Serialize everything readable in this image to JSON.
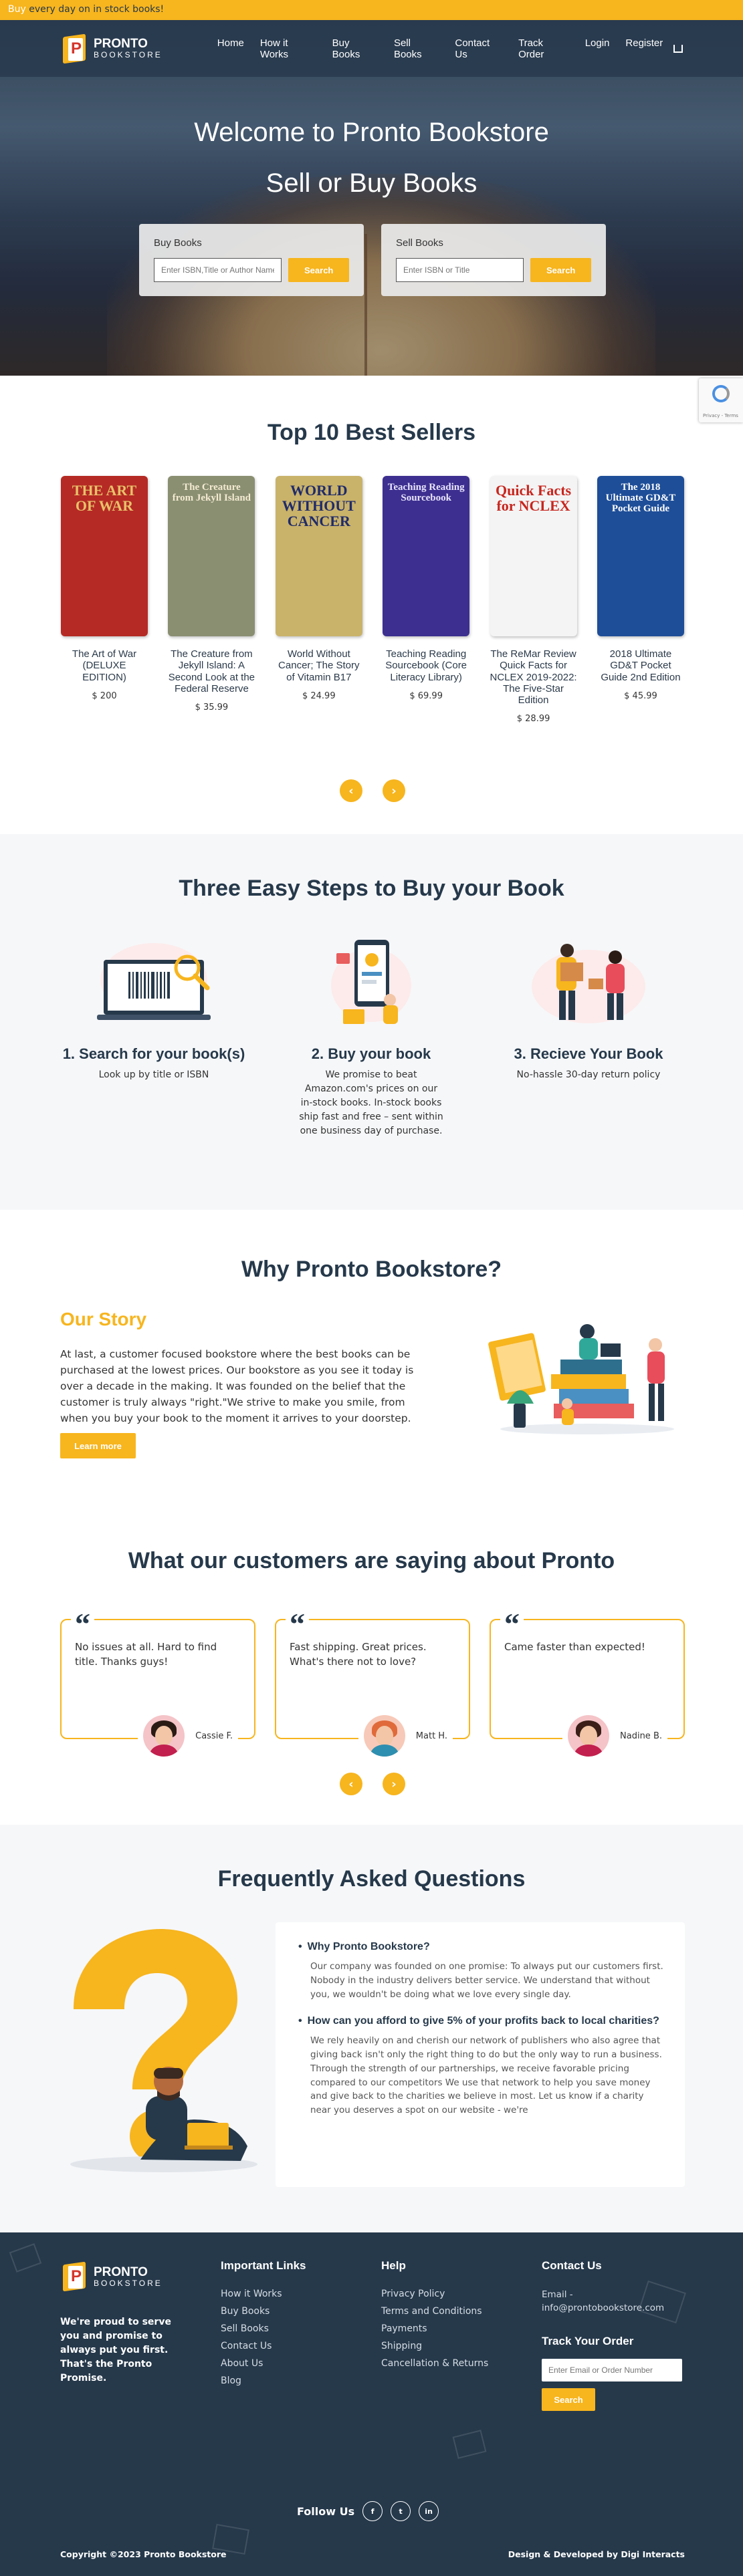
{
  "topbar": {
    "accent": "Buy",
    "text": "every day on in stock books!"
  },
  "brand": {
    "name": "PRONTO",
    "sub": "BOOKSTORE",
    "logo_letter": "P"
  },
  "nav": {
    "items": [
      "Home",
      "How it Works",
      "Buy Books",
      "Sell Books",
      "Contact Us",
      "Track Order",
      "Login",
      "Register"
    ],
    "cart_icon": "cart-icon"
  },
  "hero": {
    "title": "Welcome to Pronto Bookstore",
    "subtitle": "Sell or Buy Books",
    "buy": {
      "label": "Buy Books",
      "placeholder": "Enter ISBN,Title or Author Name",
      "button": "Search"
    },
    "sell": {
      "label": "Sell Books",
      "placeholder": "Enter ISBN or Title",
      "button": "Search"
    }
  },
  "recaptcha": {
    "text": "Privacy - Terms"
  },
  "bestsellers": {
    "title": "Top 10 Best Sellers",
    "books": [
      {
        "title": "The Art of War (DELUXE EDITION)",
        "price": "$ 200",
        "cover_text": "THE ART OF WAR",
        "bg": "#b52a24",
        "fg": "#e8c16a"
      },
      {
        "title": "The Creature from Jekyll Island: A Second Look at the Federal Reserve",
        "price": "$ 35.99",
        "cover_text": "The Creature from Jekyll Island",
        "bg": "#8a8f72",
        "fg": "#f3ead2"
      },
      {
        "title": "World Without Cancer; The Story of Vitamin B17",
        "price": "$ 24.99",
        "cover_text": "WORLD WITHOUT CANCER",
        "bg": "#c9b26a",
        "fg": "#1f2b6a"
      },
      {
        "title": "Teaching Reading Sourcebook (Core Literacy Library)",
        "price": "$ 69.99",
        "cover_text": "Teaching Reading Sourcebook",
        "bg": "#3c2f8f",
        "fg": "#e8e4ff"
      },
      {
        "title": "The ReMar Review Quick Facts for NCLEX 2019-2022: The Five-Star Edition",
        "price": "$ 28.99",
        "cover_text": "Quick Facts for NCLEX",
        "bg": "#f4f4f4",
        "fg": "#c7261e"
      },
      {
        "title": "2018 Ultimate GD&T Pocket Guide 2nd Edition",
        "price": "$ 45.99",
        "cover_text": "The 2018 Ultimate GD&T Pocket Guide",
        "bg": "#1e4e98",
        "fg": "#ffffff"
      }
    ]
  },
  "steps": {
    "title": "Three Easy Steps to Buy your Book",
    "items": [
      {
        "heading": "1. Search for your book(s)",
        "text": "Look up by title or ISBN"
      },
      {
        "heading": "2. Buy your book",
        "text": "We promise to beat Amazon.com's prices on our in-stock books. In-stock books ship fast and free – sent within one business day of purchase."
      },
      {
        "heading": "3. Recieve Your Book",
        "text": "No-hassle 30-day return policy"
      }
    ]
  },
  "why": {
    "title": "Why Pronto Bookstore?",
    "subheading": "Our Story",
    "text": "At last, a customer focused bookstore where the best books can be purchased at the lowest prices. Our bookstore as you see it today is over a decade in the making. It was founded on the belief that the customer is truly always \"right.\"We strive to make you smile, from when you buy your book to the moment it arrives to your doorstep.",
    "button": "Learn more"
  },
  "testimonials": {
    "title": "What our customers are saying about Pronto",
    "items": [
      {
        "text": "No issues at all. Hard to find title. Thanks guys!",
        "name": "Cassie F.",
        "avatar_bg": "#f4c4c8",
        "hair": "#2a1b15",
        "shirt": "#c2204e"
      },
      {
        "text": "Fast shipping. Great prices. What's there not to love?",
        "name": "Matt H.",
        "avatar_bg": "#f7c9b8",
        "hair": "#e06a3a",
        "shirt": "#2e8fb0"
      },
      {
        "text": "Came faster than expected!",
        "name": "Nadine B.",
        "avatar_bg": "#f4c4c8",
        "hair": "#3b1f18",
        "shirt": "#c2204e"
      }
    ]
  },
  "faq": {
    "title": "Frequently Asked Questions",
    "items": [
      {
        "q": "Why Pronto Bookstore?",
        "a": "Our company was founded on one promise: To always put our customers first. Nobody in the industry delivers better service. We understand that without you, we wouldn't be doing what we love every single day."
      },
      {
        "q": "How can you afford to give 5% of your profits back to local charities?",
        "a": "We rely heavily on and cherish our network of publishers who also agree that giving back isn't only the right thing to do but the only way to run a business. Through the strength of our partnerships, we receive favorable pricing compared to our competitors We use that network to help you save money and give back to the charities we believe in most. Let us know if a charity near you deserves a spot on our website - we're"
      }
    ]
  },
  "footer": {
    "tagline": "We're proud to serve you and promise to always put you first. That's the Pronto Promise.",
    "links_title": "Important Links",
    "links": [
      "How it Works",
      "Buy Books",
      "Sell Books",
      "Contact Us",
      "About Us",
      "Blog"
    ],
    "help_title": "Help",
    "help": [
      "Privacy Policy",
      "Terms and Conditions",
      "Payments",
      "Shipping",
      "Cancellation & Returns"
    ],
    "contact_title": "Contact Us",
    "email": "Email - info@prontobookstore.com",
    "track_title": "Track Your Order",
    "track_placeholder": "Enter Email or Order Number",
    "track_button": "Search",
    "follow": "Follow Us",
    "social": [
      "f",
      "t",
      "in"
    ],
    "copyright": "Copyright ©2023 Pronto Bookstore",
    "credit": "Design & Developed by Digi Interacts"
  },
  "colors": {
    "accent": "#f7b51e",
    "navy": "#26394b",
    "light_bg": "#f6f7f9"
  }
}
